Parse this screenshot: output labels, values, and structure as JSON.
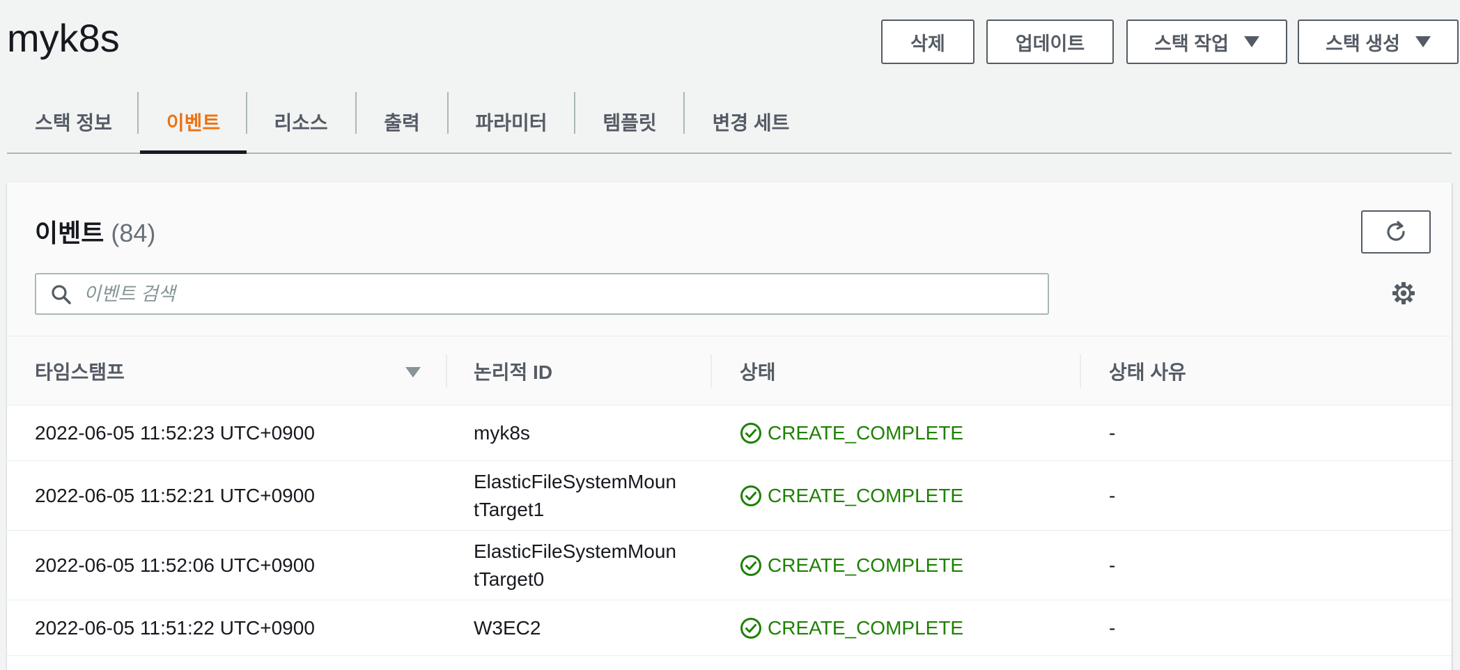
{
  "header": {
    "title": "myk8s",
    "buttons": {
      "delete": "삭제",
      "update": "업데이트",
      "stack_actions": "스택 작업",
      "create_stack": "스택 생성"
    }
  },
  "tabs": [
    {
      "label": "스택 정보"
    },
    {
      "label": "이벤트"
    },
    {
      "label": "리소스"
    },
    {
      "label": "출력"
    },
    {
      "label": "파라미터"
    },
    {
      "label": "템플릿"
    },
    {
      "label": "변경 세트"
    }
  ],
  "active_tab": "이벤트",
  "events": {
    "title": "이벤트",
    "count": "(84)",
    "search_placeholder": "이벤트 검색",
    "columns": {
      "timestamp": "타임스탬프",
      "logical_id": "논리적 ID",
      "status": "상태",
      "status_reason": "상태 사유"
    },
    "rows": [
      {
        "timestamp": "2022-06-05 11:52:23 UTC+0900",
        "logical_id": "myk8s",
        "status": "CREATE_COMPLETE",
        "reason": "-"
      },
      {
        "timestamp": "2022-06-05 11:52:21 UTC+0900",
        "logical_id": "ElasticFileSystemMountTarget1",
        "logical_id_line1": "ElasticFileSystemMoun",
        "logical_id_line2": "tTarget1",
        "status": "CREATE_COMPLETE",
        "reason": "-"
      },
      {
        "timestamp": "2022-06-05 11:52:06 UTC+0900",
        "logical_id": "ElasticFileSystemMountTarget0",
        "logical_id_line1": "ElasticFileSystemMoun",
        "logical_id_line2": "tTarget0",
        "status": "CREATE_COMPLETE",
        "reason": "-"
      },
      {
        "timestamp": "2022-06-05 11:51:22 UTC+0900",
        "logical_id": "W3EC2",
        "status": "CREATE_COMPLETE",
        "reason": "-"
      }
    ]
  },
  "colors": {
    "active_tab": "#ec7211",
    "success": "#1d8102",
    "text": "#16191f",
    "secondary_text": "#545b64"
  },
  "icons": [
    "caret-down-icon",
    "refresh-icon",
    "search-icon",
    "gear-icon",
    "sort-caret-icon",
    "status-success-icon"
  ]
}
